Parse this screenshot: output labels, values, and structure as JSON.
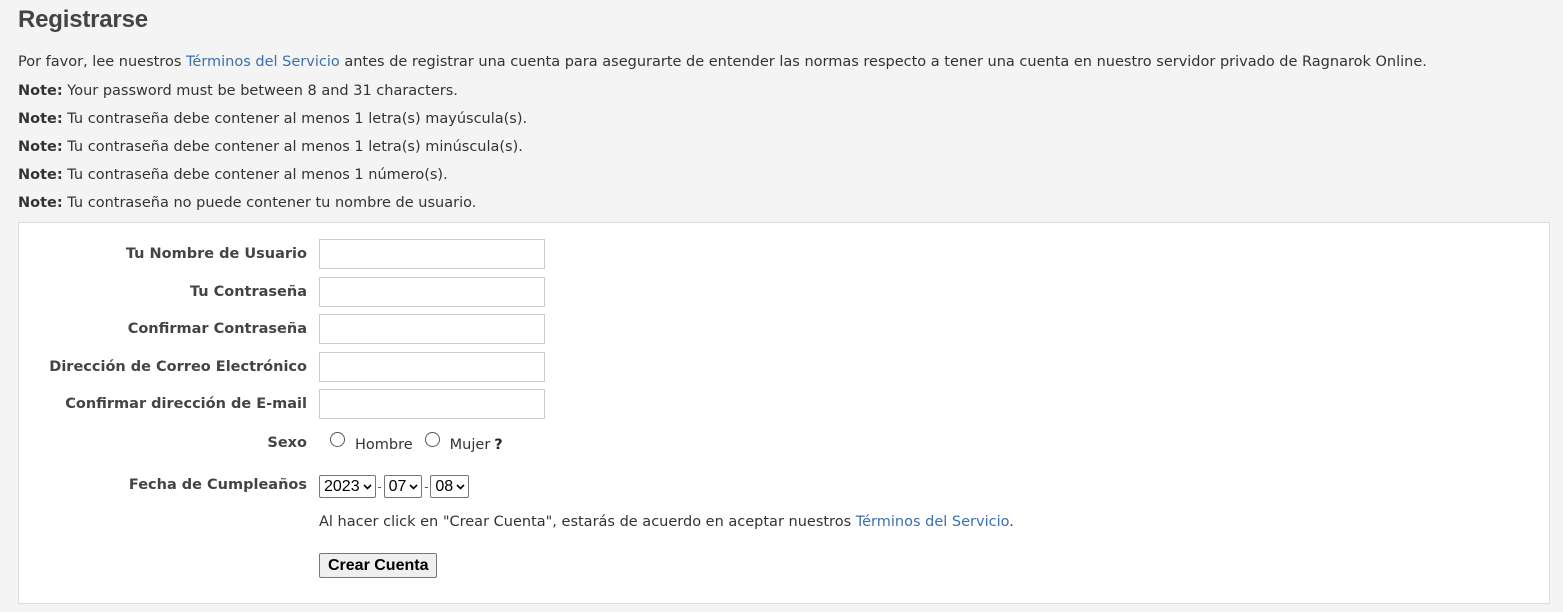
{
  "header": {
    "title": "Registrarse"
  },
  "intro": {
    "before": "Por favor, lee nuestros ",
    "link": "Términos del Servicio",
    "after": " antes de registrar una cuenta para asegurarte de entender las normas respecto a tener una cuenta en nuestro servidor privado de Ragnarok Online."
  },
  "notes": [
    {
      "label": "Note:",
      "text": " Your password must be between 8 and 31 characters."
    },
    {
      "label": "Note:",
      "text": " Tu contraseña debe contener al menos 1 letra(s) mayúscula(s)."
    },
    {
      "label": "Note:",
      "text": " Tu contraseña debe contener al menos 1 letra(s) minúscula(s)."
    },
    {
      "label": "Note:",
      "text": " Tu contraseña debe contener al menos 1 número(s)."
    },
    {
      "label": "Note:",
      "text": " Tu contraseña no puede contener tu nombre de usuario."
    }
  ],
  "form": {
    "username_label": "Tu Nombre de Usuario",
    "username_value": "",
    "password_label": "Tu Contraseña",
    "password_value": "",
    "confirm_password_label": "Confirmar Contraseña",
    "confirm_password_value": "",
    "email_label": "Dirección de Correo Electrónico",
    "email_value": "",
    "confirm_email_label": "Confirmar dirección de E-mail",
    "confirm_email_value": "",
    "gender_label": "Sexo",
    "gender_options": [
      "Hombre",
      "Mujer"
    ],
    "gender_help": "?",
    "birthdate_label": "Fecha de Cumpleaños",
    "birthdate": {
      "year": "2023",
      "month": "07",
      "day": "08",
      "separator": "-"
    },
    "agree_before": "Al hacer click en \"Crear Cuenta\", estarás de acuerdo en aceptar nuestros ",
    "agree_link": "Términos del Servicio",
    "agree_after": ".",
    "submit_label": "Crear Cuenta"
  },
  "colors": {
    "background": "#f4f4f4",
    "panel": "#ffffff",
    "link": "#3a6fb0",
    "text": "#333333"
  }
}
